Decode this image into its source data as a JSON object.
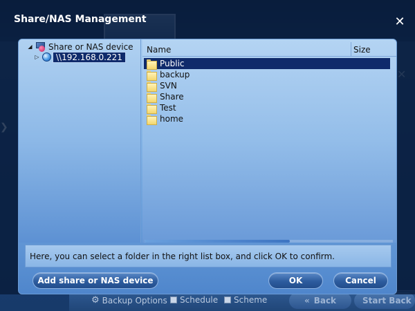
{
  "dialog": {
    "title": "Share/NAS Management",
    "close_icon": "close-icon"
  },
  "tree": {
    "root_label": "Share or NAS device",
    "child_label": "\\\\192.168.0.221"
  },
  "list": {
    "columns": {
      "name": "Name",
      "size": "Size"
    },
    "items": [
      {
        "label": "Public",
        "selected": true
      },
      {
        "label": "backup",
        "selected": false
      },
      {
        "label": "SVN",
        "selected": false
      },
      {
        "label": "Share",
        "selected": false
      },
      {
        "label": "Test",
        "selected": false
      },
      {
        "label": "home",
        "selected": false
      }
    ]
  },
  "info_text": "Here, you can select a folder in the right list box, and click OK to confirm.",
  "buttons": {
    "add": "Add share or NAS device",
    "ok": "OK",
    "cancel": "Cancel"
  },
  "background": {
    "bottom_items": [
      "Backup Options",
      "Schedule",
      "Scheme"
    ],
    "back_label": "Back",
    "start_label": "Start Back"
  },
  "colors": {
    "selection": "#0f2a6b",
    "button": "#2d5c9e",
    "panel": "#7eb0e4"
  }
}
